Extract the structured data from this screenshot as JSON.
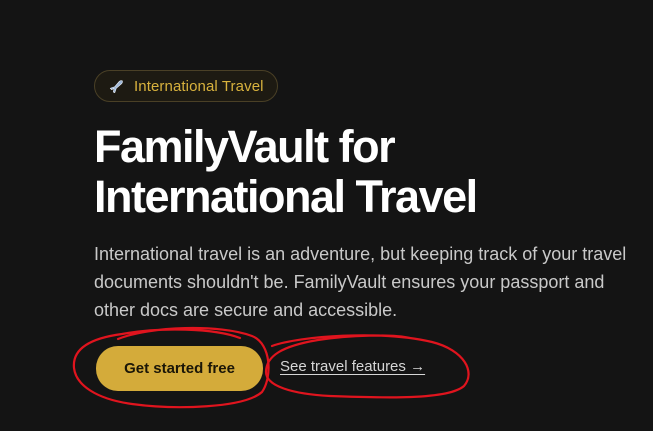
{
  "badge": {
    "icon": "airplane-icon",
    "label": "International Travel"
  },
  "hero": {
    "title_line1": "FamilyVault for",
    "title_line2": "International Travel",
    "description": "International travel is an adventure, but keeping track of your travel documents shouldn't be. FamilyVault ensures your passport and other docs are secure and accessible."
  },
  "actions": {
    "primary_label": "Get started free",
    "secondary_label": "See travel features →"
  },
  "colors": {
    "background": "#141414",
    "accent": "#d4ab3a",
    "annotation": "#e0141e"
  }
}
